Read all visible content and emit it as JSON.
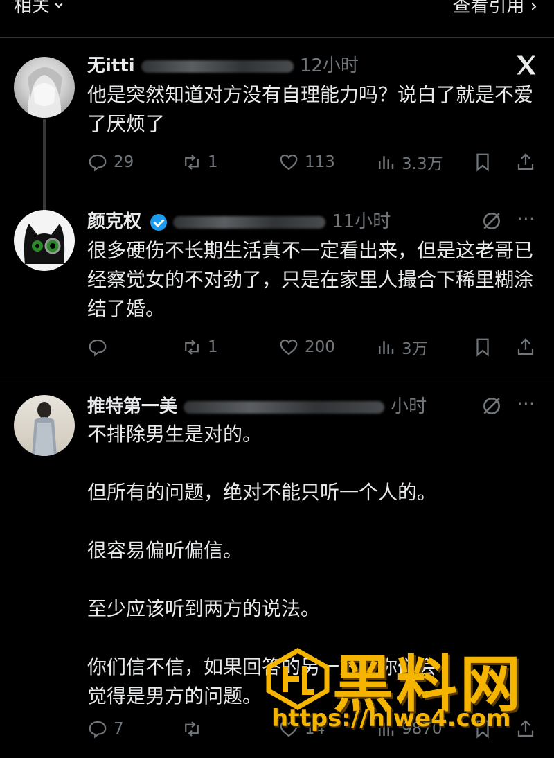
{
  "topbar": {
    "left_label": "相关",
    "right_label": "查看引用"
  },
  "tweets": [
    {
      "author": "无itti",
      "time": "12小时",
      "text": "他是突然知道对方没有自理能力吗？说白了就是不爱了厌烦了",
      "replies": "29",
      "retweets": "1",
      "likes": "113",
      "views": "3.3万"
    },
    {
      "author": "颜克权",
      "time": "11小时",
      "text": "很多硬伤不长期生活真不一定看出来，但是这老哥已经察觉女的不对劲了，只是在家里人撮合下稀里糊涂结了婚。",
      "replies": "",
      "retweets": "1",
      "likes": "200",
      "views": "3万"
    },
    {
      "author": "推特第一美",
      "time": "小时",
      "text": "不排除男生是对的。\n\n但所有的问题，绝对不能只听一个人的。\n\n很容易偏听偏信。\n\n至少应该听到两方的说法。\n\n你们信不信，如果回答的另一方，你们会\n觉得是男方的问题。",
      "replies": "7",
      "retweets": "",
      "likes": "14",
      "views": "9870"
    }
  ],
  "watermark": {
    "title": "黑料网",
    "url": "https://hlwe4.com"
  },
  "colors": {
    "background": "#000000",
    "text": "#e7e9ea",
    "muted": "#71767b",
    "verified": "#1d9bf0",
    "watermark": "#f5b400"
  },
  "icons": [
    "reply-icon",
    "retweet-icon",
    "like-icon",
    "views-icon",
    "bookmark-icon",
    "share-icon",
    "x-logo-icon",
    "grok-icon",
    "more-icon"
  ]
}
